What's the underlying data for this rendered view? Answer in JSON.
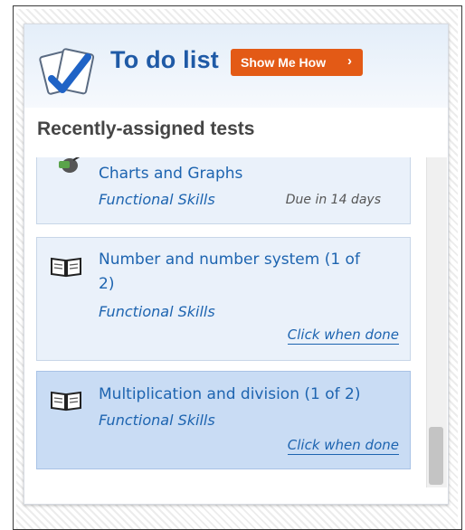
{
  "header": {
    "title": "To do list",
    "show_me_how": "Show Me How",
    "show_me_how_chevron": "›",
    "icon": "todo-checklist-icon",
    "accent_color": "#1f5aa6",
    "button_color": "#e35a16"
  },
  "section": {
    "title": "Recently-assigned tests"
  },
  "tests": [
    {
      "title": "Charts and Graphs",
      "subject": "Functional Skills",
      "due": "Due in 14 days",
      "icon": "test-pencil-icon"
    },
    {
      "title": "Number and number system (1 of 2)",
      "subject": "Functional Skills",
      "action": "Click when done",
      "icon": "book-icon"
    },
    {
      "title": "Multiplication and division (1 of 2)",
      "subject": "Functional Skills",
      "action": "Click when done",
      "icon": "book-icon"
    }
  ]
}
